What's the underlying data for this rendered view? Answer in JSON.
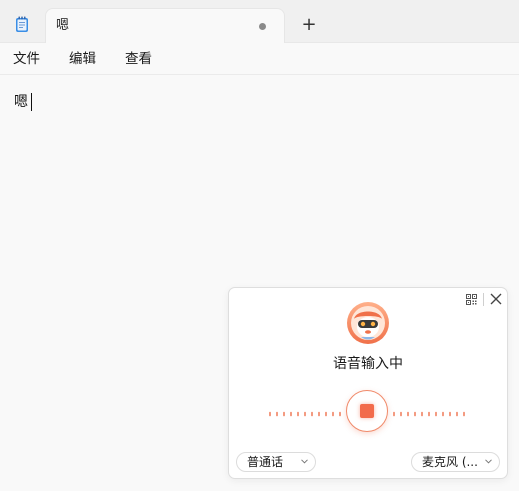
{
  "tab": {
    "title": "嗯"
  },
  "new_tab_glyph": "+",
  "menu": {
    "items": [
      "文件",
      "编辑",
      "查看"
    ]
  },
  "editor": {
    "text": "嗯"
  },
  "voice_input": {
    "status": "语音输入中",
    "language_select": "普通话",
    "microphone_select": "麦克风 (..."
  },
  "colors": {
    "accent": "#f26b4b",
    "wave": "#f08060"
  },
  "icons": {
    "app": "notepad-icon",
    "unsaved": "unsaved-dot-icon",
    "qr": "qr-code-icon",
    "close": "close-icon",
    "mascot": "mascot-icon",
    "stop": "stop-icon",
    "chevron": "chevron-down-icon"
  }
}
